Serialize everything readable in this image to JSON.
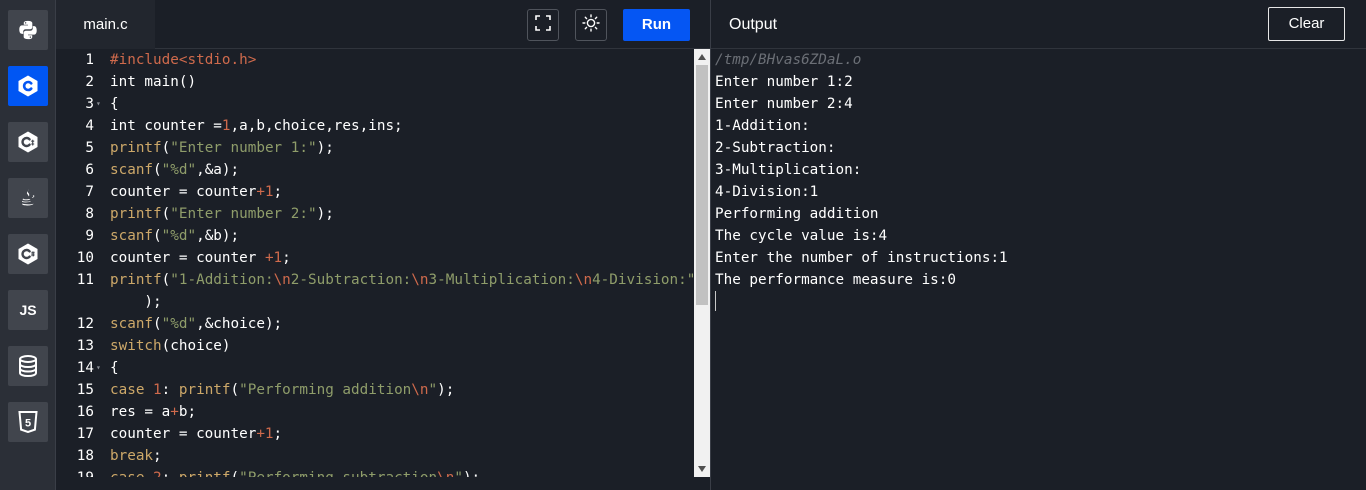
{
  "sidebar": {
    "languages": [
      {
        "name": "python",
        "icon": "python-icon"
      },
      {
        "name": "c",
        "icon": "c-icon",
        "active": true
      },
      {
        "name": "cpp",
        "icon": "cpp-icon"
      },
      {
        "name": "java",
        "icon": "java-icon"
      },
      {
        "name": "csharp",
        "icon": "csharp-icon"
      },
      {
        "name": "javascript",
        "icon": "js-icon",
        "label": "JS"
      },
      {
        "name": "sql",
        "icon": "database-icon"
      },
      {
        "name": "html",
        "icon": "html5-icon",
        "label": "5"
      }
    ]
  },
  "editor": {
    "file_tab": "main.c",
    "run_label": "Run",
    "lines": [
      {
        "n": "1",
        "tokens": [
          [
            "pp",
            "#include"
          ],
          [
            "num",
            "<stdio.h>"
          ]
        ]
      },
      {
        "n": "2",
        "tokens": [
          [
            "plain",
            "int main()"
          ]
        ]
      },
      {
        "n": "3",
        "fold": true,
        "tokens": [
          [
            "plain",
            "{"
          ]
        ]
      },
      {
        "n": "4",
        "tokens": [
          [
            "plain",
            "int counter ="
          ],
          [
            "num",
            "1"
          ],
          [
            "plain",
            ",a,b,choice,res,ins;"
          ]
        ]
      },
      {
        "n": "5",
        "tokens": [
          [
            "kw",
            "printf"
          ],
          [
            "plain",
            "("
          ],
          [
            "str",
            "\"Enter number 1:\""
          ],
          [
            "plain",
            ");"
          ]
        ]
      },
      {
        "n": "6",
        "tokens": [
          [
            "kw",
            "scanf"
          ],
          [
            "plain",
            "("
          ],
          [
            "str",
            "\"%d\""
          ],
          [
            "plain",
            ",&a);"
          ]
        ]
      },
      {
        "n": "7",
        "tokens": [
          [
            "plain",
            "counter = counter"
          ],
          [
            "num",
            "+1"
          ],
          [
            "plain",
            ";"
          ]
        ]
      },
      {
        "n": "8",
        "tokens": [
          [
            "kw",
            "printf"
          ],
          [
            "plain",
            "("
          ],
          [
            "str",
            "\"Enter number 2:\""
          ],
          [
            "plain",
            ");"
          ]
        ]
      },
      {
        "n": "9",
        "tokens": [
          [
            "kw",
            "scanf"
          ],
          [
            "plain",
            "("
          ],
          [
            "str",
            "\"%d\""
          ],
          [
            "plain",
            ",&b);"
          ]
        ]
      },
      {
        "n": "10",
        "tokens": [
          [
            "plain",
            "counter = counter "
          ],
          [
            "num",
            "+1"
          ],
          [
            "plain",
            ";"
          ]
        ]
      },
      {
        "n": "11",
        "tokens": [
          [
            "kw",
            "printf"
          ],
          [
            "plain",
            "("
          ],
          [
            "str",
            "\"1-Addition:"
          ],
          [
            "num",
            "\\n"
          ],
          [
            "str",
            "2-Subtraction:"
          ],
          [
            "num",
            "\\n"
          ],
          [
            "str",
            "3-Multiplication:"
          ],
          [
            "num",
            "\\n"
          ],
          [
            "str",
            "4-Division:\""
          ]
        ]
      },
      {
        "n": "",
        "tokens": [
          [
            "plain",
            "    );"
          ]
        ]
      },
      {
        "n": "12",
        "tokens": [
          [
            "kw",
            "scanf"
          ],
          [
            "plain",
            "("
          ],
          [
            "str",
            "\"%d\""
          ],
          [
            "plain",
            ",&choice);"
          ]
        ]
      },
      {
        "n": "13",
        "tokens": [
          [
            "kw",
            "switch"
          ],
          [
            "plain",
            "(choice)"
          ]
        ]
      },
      {
        "n": "14",
        "fold": true,
        "tokens": [
          [
            "plain",
            "{"
          ]
        ]
      },
      {
        "n": "15",
        "tokens": [
          [
            "kw",
            "case"
          ],
          [
            "plain",
            " "
          ],
          [
            "num",
            "1"
          ],
          [
            "plain",
            ": "
          ],
          [
            "kw",
            "printf"
          ],
          [
            "plain",
            "("
          ],
          [
            "str",
            "\"Performing addition"
          ],
          [
            "num",
            "\\n"
          ],
          [
            "str",
            "\""
          ],
          [
            "plain",
            ");"
          ]
        ]
      },
      {
        "n": "16",
        "tokens": [
          [
            "plain",
            "res = a"
          ],
          [
            "num",
            "+"
          ],
          [
            "plain",
            "b;"
          ]
        ]
      },
      {
        "n": "17",
        "tokens": [
          [
            "plain",
            "counter = counter"
          ],
          [
            "num",
            "+1"
          ],
          [
            "plain",
            ";"
          ]
        ]
      },
      {
        "n": "18",
        "tokens": [
          [
            "kw",
            "break"
          ],
          [
            "plain",
            ";"
          ]
        ]
      },
      {
        "n": "19",
        "tokens": [
          [
            "kw",
            "case"
          ],
          [
            "plain",
            " "
          ],
          [
            "num",
            "2"
          ],
          [
            "plain",
            ": "
          ],
          [
            "kw",
            "printf"
          ],
          [
            "plain",
            "("
          ],
          [
            "str",
            "\"Performing subtraction"
          ],
          [
            "num",
            "\\n"
          ],
          [
            "str",
            "\""
          ],
          [
            "plain",
            ");"
          ]
        ]
      }
    ]
  },
  "output": {
    "title": "Output",
    "clear_label": "Clear",
    "path": "/tmp/BHvas6ZDaL.o",
    "lines": [
      "Enter number 1:2",
      "Enter number 2:4",
      "1-Addition:",
      "2-Subtraction:",
      "3-Multiplication:",
      "4-Division:1",
      "Performing addition",
      "The cycle value is:4",
      "Enter the number of instructions:1",
      "The performance measure is:0"
    ]
  },
  "colors": {
    "accent": "#0556f3",
    "background": "#1b1f27",
    "sidebar": "#2b2f37",
    "keyword": "#cda869",
    "string": "#8f9d6a",
    "number": "#cf6a4c"
  }
}
